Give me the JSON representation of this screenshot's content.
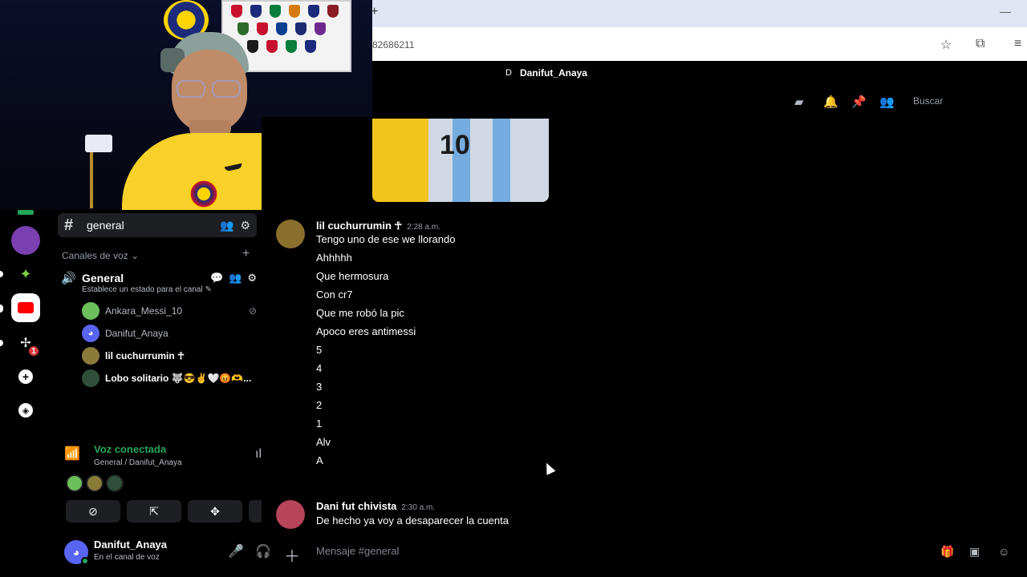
{
  "browser": {
    "url_fragment": "82686211",
    "new_tab_label": "+",
    "minimize_label": "—"
  },
  "header": {
    "dm_initial": "D",
    "dm_name": "Danifut_Anaya",
    "search_placeholder": "Buscar"
  },
  "servers": [
    {
      "name": "server-green",
      "color": "#23a559"
    },
    {
      "name": "server-purple",
      "color": "#7a3fb0"
    },
    {
      "name": "server-pixel",
      "color": "#3a7d2b"
    },
    {
      "name": "youtube",
      "color": "#ffffff"
    },
    {
      "name": "server-compass",
      "color": "#2b2d31",
      "badge": "1"
    }
  ],
  "sidebar": {
    "channel_name": "general",
    "voice_category": "Canales de voz",
    "voice_channel": "General",
    "channel_status": "Establece un estado para el canal",
    "members": [
      {
        "name": "Ankara_Messi_10",
        "color": "#6dbf5b",
        "active": false
      },
      {
        "name": "Danifut_Anaya",
        "color": "#5865f2",
        "active": false
      },
      {
        "name": "lil cuchurrumin ☥",
        "color": "#8a7b3a",
        "active": true
      },
      {
        "name": "Lobo solitario 🐺😎✌️🤍😡🫶...",
        "color": "#2f4f3a",
        "active": true
      }
    ]
  },
  "voice": {
    "title": "Voz conectada",
    "subtitle": "General / Danifut_Anaya"
  },
  "user": {
    "name": "Danifut_Anaya",
    "status": "En el canal de voz"
  },
  "messages": [
    {
      "author": "lil cuchurrumin ☥",
      "time": "2:28 a.m.",
      "avatar_color": "#8a6f2c",
      "lines": [
        "Tengo uno de ese we llorando",
        "Ahhhhh",
        "Que hermosura",
        "Con cr7",
        "Que me robó la pic",
        "Apoco eres antimessi",
        "5",
        "4",
        "3",
        "2",
        "1",
        "Alv",
        "A"
      ]
    },
    {
      "author": "Dani fut chivista",
      "time": "2:30 a.m.",
      "avatar_color": "#b8445a",
      "lines": [
        "De hecho ya voy a desaparecer la cuenta"
      ]
    }
  ],
  "composer": {
    "placeholder": "Mensaje #general"
  },
  "image_attachment": {
    "jersey_number": "10"
  }
}
